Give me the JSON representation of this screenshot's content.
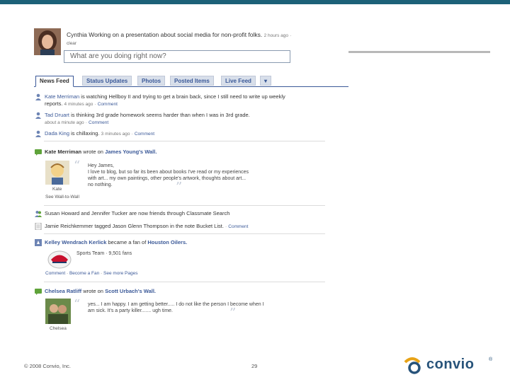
{
  "status": {
    "user": "Cynthia",
    "text": "Working on a presentation about social media for non-profit folks.",
    "time": "2 hours ago",
    "clear": "clear",
    "placeholder": "What are you doing right now?"
  },
  "tabs": [
    "News Feed",
    "Status Updates",
    "Photos",
    "Posted Items",
    "Live Feed",
    "▾"
  ],
  "feed": {
    "item1": {
      "name": "Kate Merriman",
      "text": "is watching Hellboy II and trying to get a brain back, since I still need to write up weekly reports.",
      "meta": "4 minutes ago",
      "comment": "Comment"
    },
    "item2": {
      "name": "Tad Druart",
      "text": "is thinking 3rd grade homework seems harder than when I was in 3rd grade.",
      "meta": "about a minute ago",
      "comment": "Comment"
    },
    "item3": {
      "name": "Dada King",
      "text": "is chillaxing.",
      "meta": "3 minutes ago",
      "comment": "Comment"
    },
    "wall1": {
      "author": "Kate Merriman",
      "verb": "wrote on",
      "target": "James Young's Wall.",
      "greeting": "Hey James,",
      "quote": "I love to blog, but so far its been about books I've read or my experiences with art... my own paintings, other people's artwork, thoughts about art... no nothing.",
      "caption": "Kate",
      "see_link": "See Wall-to-Wall"
    },
    "item4": {
      "text": "Susan Howard and Jennifer Tucker are now friends through Classmate Search"
    },
    "item5": {
      "text": "Jamie Reichkemmer tagged Jason Glenn Thompson in the note Bucket List.",
      "comment": "Comment"
    },
    "fan": {
      "name": "Kelley Wendrach Kerlick",
      "verb": "became a fan of",
      "target": "Houston Oilers.",
      "sport": "Sports Team",
      "fans": "9,501 fans",
      "comment": "Comment",
      "become": "Become a Fan",
      "see_more": "See more Pages"
    },
    "wall2": {
      "author": "Chelsea Ratliff",
      "verb": "wrote on",
      "target": "Scott Urbach's Wall.",
      "quote": "yes... I am happy. I am getting better..... I do not like the person I become when I am sick. It's a party killer....... ugh time.",
      "caption": "Chelsea"
    }
  },
  "footer": {
    "copyright": "© 2008 Convio, Inc.",
    "page": "29"
  },
  "logo": {
    "text": "convio",
    "reg": "®"
  },
  "colors": {
    "fb_blue": "#3b5998",
    "brand_bar": "#1c6178",
    "logo_blue": "#27537a",
    "logo_gold": "#e8a317"
  }
}
